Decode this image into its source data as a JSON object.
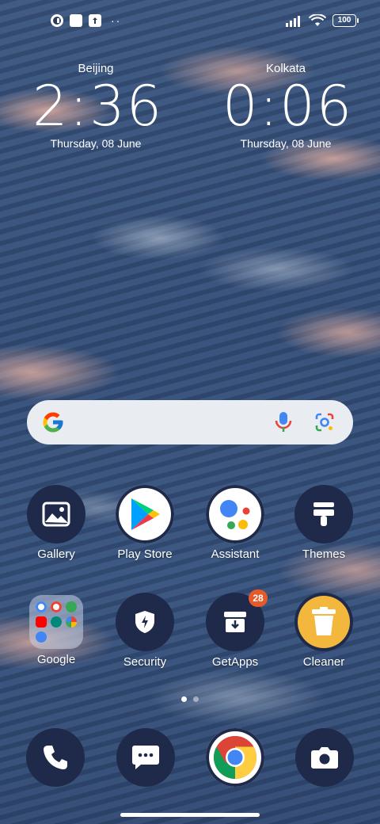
{
  "status_bar": {
    "left_icons": [
      "status-app-icon",
      "notification-square-icon",
      "upload-icon"
    ],
    "overflow": "··",
    "battery": "100"
  },
  "clocks": [
    {
      "city": "Beijing",
      "time": "2:36",
      "date": "Thursday, 08 June"
    },
    {
      "city": "Kolkata",
      "time": "0:06",
      "date": "Thursday, 08 June"
    }
  ],
  "search": {
    "logo": "G",
    "icons": [
      "microphone-icon",
      "google-lens-icon"
    ]
  },
  "apps_row1": [
    {
      "label": "Gallery",
      "icon": "gallery-icon"
    },
    {
      "label": "Play Store",
      "icon": "play-store-icon"
    },
    {
      "label": "Assistant",
      "icon": "assistant-icon"
    },
    {
      "label": "Themes",
      "icon": "themes-icon"
    }
  ],
  "apps_row2": [
    {
      "label": "Google",
      "icon": "google-folder-icon"
    },
    {
      "label": "Security",
      "icon": "security-icon"
    },
    {
      "label": "GetApps",
      "icon": "getapps-icon",
      "badge": "28"
    },
    {
      "label": "Cleaner",
      "icon": "cleaner-icon"
    }
  ],
  "dock": [
    {
      "icon": "phone-icon"
    },
    {
      "icon": "messages-icon"
    },
    {
      "icon": "chrome-icon"
    },
    {
      "icon": "camera-icon"
    }
  ],
  "page_indicator": {
    "pages": 2,
    "current": 1
  },
  "colors": {
    "badge": "#e65a2a",
    "dark_icon": "#1f2a4a",
    "cleaner": "#f4b73d"
  }
}
